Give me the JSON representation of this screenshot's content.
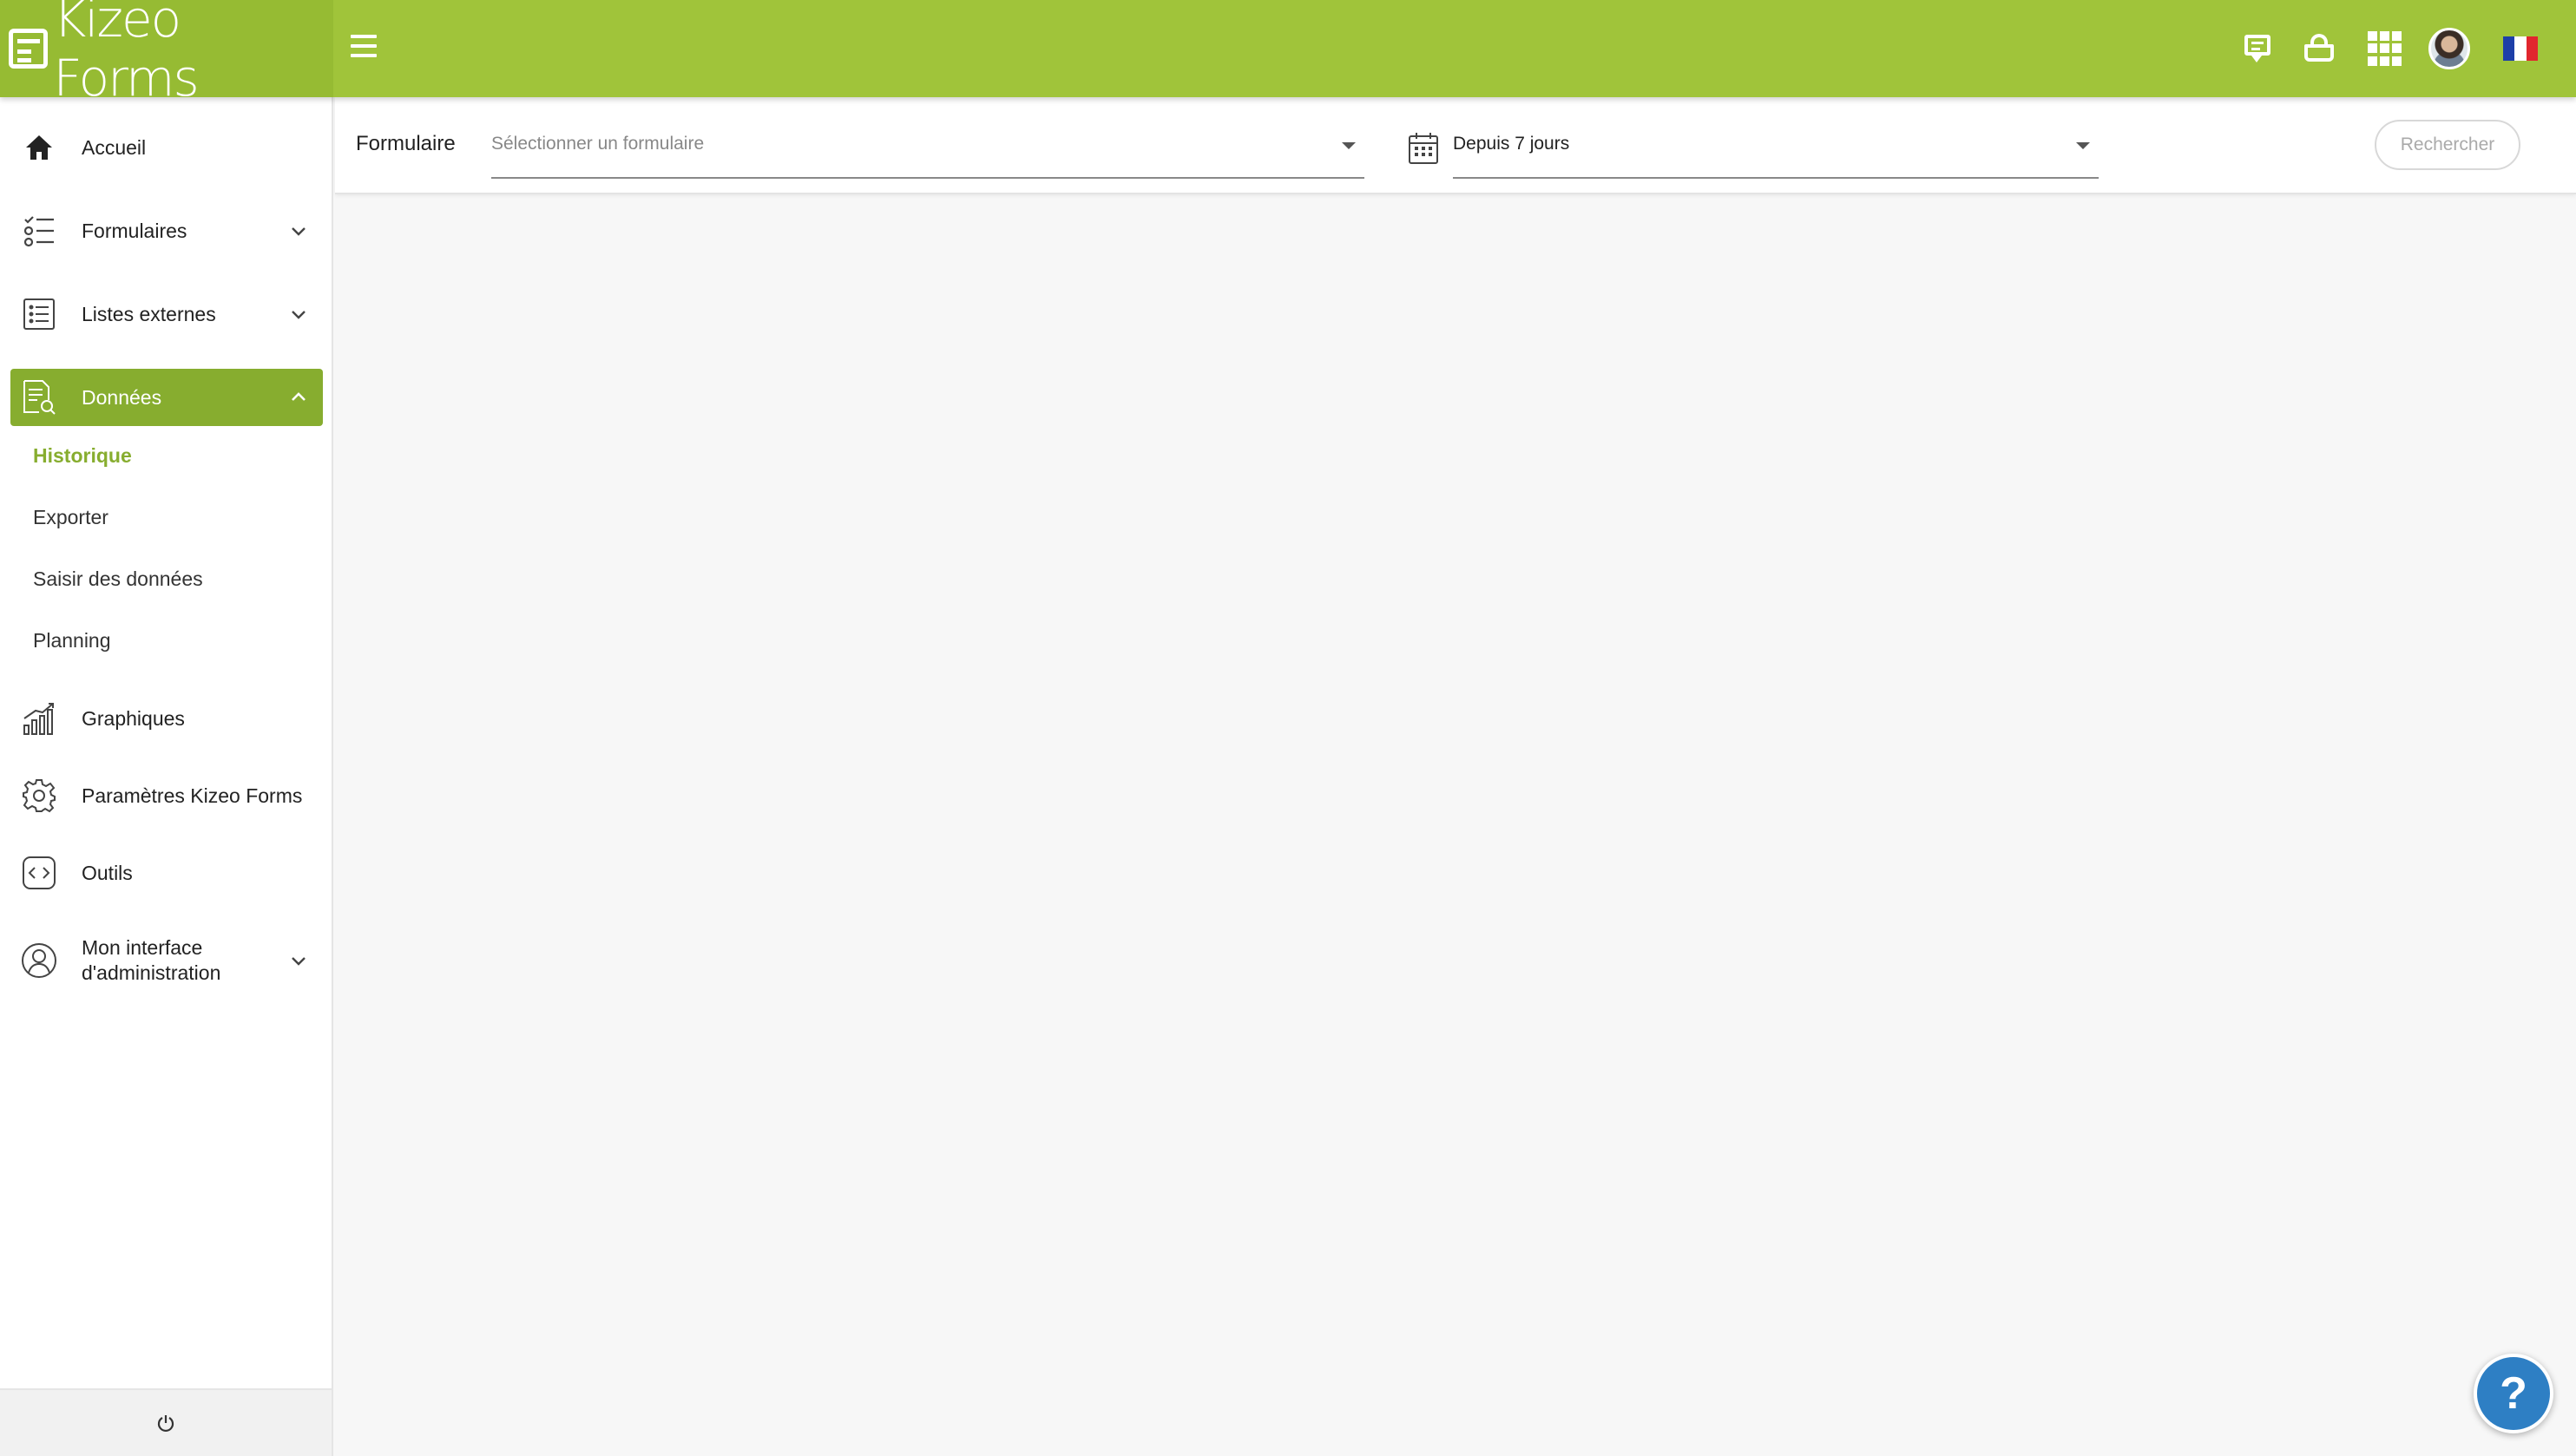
{
  "app": {
    "logo_text": "Kizeo Forms"
  },
  "topbar": {
    "icons": [
      "hamburger-menu-icon",
      "chat-icon",
      "basket-icon",
      "apps-grid-icon",
      "user-avatar",
      "french-flag-icon"
    ],
    "accent_color": "#a0c43a"
  },
  "sidebar": {
    "items": [
      {
        "label": "Accueil",
        "icon": "home-icon"
      },
      {
        "label": "Formulaires",
        "icon": "form-list-icon",
        "expandable": true
      },
      {
        "label": "Listes externes",
        "icon": "external-list-icon",
        "expandable": true
      },
      {
        "label": "Données",
        "icon": "data-search-icon",
        "expandable": true,
        "expanded": true,
        "active": true
      },
      {
        "label": "Graphiques",
        "icon": "chart-icon"
      },
      {
        "label": "Paramètres Kizeo Forms",
        "icon": "gear-icon"
      },
      {
        "label": "Outils",
        "icon": "code-icon"
      },
      {
        "label": "Mon interface d'administration",
        "line1": "Mon interface",
        "line2": "d'administration",
        "icon": "user-circle-icon",
        "expandable": true
      }
    ],
    "subitems": [
      {
        "label": "Historique",
        "current": true
      },
      {
        "label": "Exporter"
      },
      {
        "label": "Saisir des données"
      },
      {
        "label": "Planning"
      }
    ],
    "footer_icon": "power-icon",
    "active_color": "#87ad2f"
  },
  "filters": {
    "form_label": "Formulaire",
    "form_placeholder": "Sélectionner un formulaire",
    "period_value": "Depuis 7 jours",
    "search_button": "Rechercher"
  },
  "help": {
    "label": "?"
  }
}
